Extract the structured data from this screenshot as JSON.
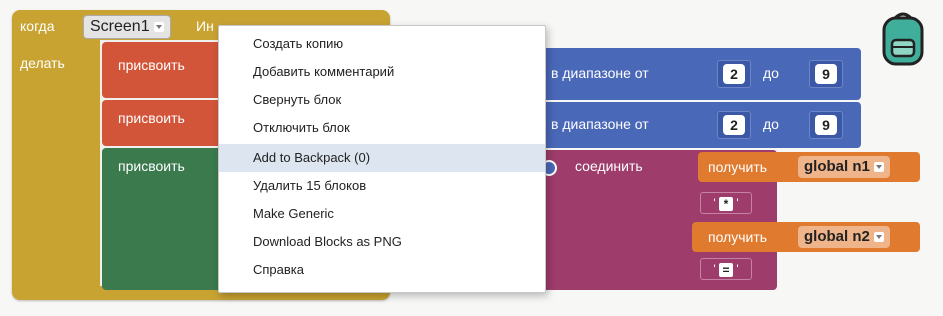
{
  "event_block": {
    "keyword": "когда",
    "component": "Screen1",
    "event_partial": "Ин",
    "do_label": "делать"
  },
  "set_blocks": [
    {
      "label": "присвоить"
    },
    {
      "label": "присвоить"
    },
    {
      "label": "присвоить"
    }
  ],
  "range_blocks": [
    {
      "from_label": "в диапазоне от",
      "from_value": "2",
      "to_label": "до",
      "to_value": "9"
    },
    {
      "from_label": "в диапазоне от",
      "from_value": "2",
      "to_label": "до",
      "to_value": "9"
    }
  ],
  "join_block": {
    "label": "соединить"
  },
  "text_chips": [
    {
      "value": "*"
    },
    {
      "value": "="
    }
  ],
  "get_blocks": [
    {
      "label": "получить",
      "variable": "global n1"
    },
    {
      "label": "получить",
      "variable": "global n2"
    }
  ],
  "context_menu": {
    "items": [
      {
        "label": "Создать копию"
      },
      {
        "label": "Добавить комментарий"
      },
      {
        "label": "Свернуть блок"
      },
      {
        "label": "Отключить блок"
      },
      {
        "label": "Add to Backpack (0)"
      },
      {
        "label": "Удалить 15 блоков"
      },
      {
        "label": "Make Generic"
      },
      {
        "label": "Download Blocks as PNG"
      },
      {
        "label": "Справка"
      }
    ],
    "highlighted_index": 4
  },
  "icons": {
    "backpack": "backpack-icon"
  },
  "colors": {
    "event": "#c8a332",
    "set": "#d2553a",
    "set_green": "#3a7a4c",
    "range": "#4a68b8",
    "join": "#9e3c6c",
    "get": "#e07a2e",
    "backpack": "#3fae9a"
  }
}
